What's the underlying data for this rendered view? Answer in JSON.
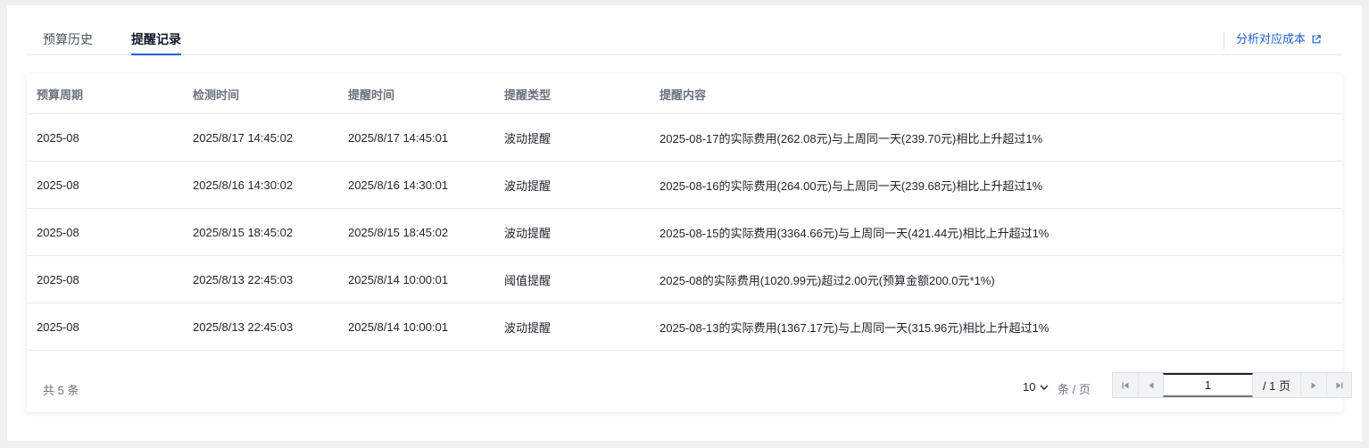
{
  "tabs": [
    {
      "label": "预算历史",
      "active": false
    },
    {
      "label": "提醒记录",
      "active": true
    }
  ],
  "analyze_link": {
    "label": "分析对应成本",
    "icon": "external-link-icon"
  },
  "table": {
    "columns": [
      "预算周期",
      "检测时间",
      "提醒时间",
      "提醒类型",
      "提醒内容"
    ],
    "rows": [
      [
        "2025-08",
        "2025/8/17 14:45:02",
        "2025/8/17 14:45:01",
        "波动提醒",
        "2025-08-17的实际费用(262.08元)与上周同一天(239.70元)相比上升超过1%"
      ],
      [
        "2025-08",
        "2025/8/16 14:30:02",
        "2025/8/16 14:30:01",
        "波动提醒",
        "2025-08-16的实际费用(264.00元)与上周同一天(239.68元)相比上升超过1%"
      ],
      [
        "2025-08",
        "2025/8/15 18:45:02",
        "2025/8/15 18:45:02",
        "波动提醒",
        "2025-08-15的实际费用(3364.66元)与上周同一天(421.44元)相比上升超过1%"
      ],
      [
        "2025-08",
        "2025/8/13 22:45:03",
        "2025/8/14 10:00:01",
        "阈值提醒",
        "2025-08的实际费用(1020.99元)超过2.00元(预算金额200.0元*1%)"
      ],
      [
        "2025-08",
        "2025/8/13 22:45:03",
        "2025/8/14 10:00:01",
        "波动提醒",
        "2025-08-13的实际费用(1367.17元)与上周同一天(315.96元)相比上升超过1%"
      ]
    ]
  },
  "pagination": {
    "total_text": "共 5 条",
    "page_size": "10",
    "per_page_text": "条 / 页",
    "current_page": "1",
    "total_pages_text": "/ 1 页"
  },
  "colors": {
    "accent": "#1f5fd6",
    "background": "#eef0f4",
    "card": "#ffffff",
    "muted_text": "#6b7280"
  }
}
